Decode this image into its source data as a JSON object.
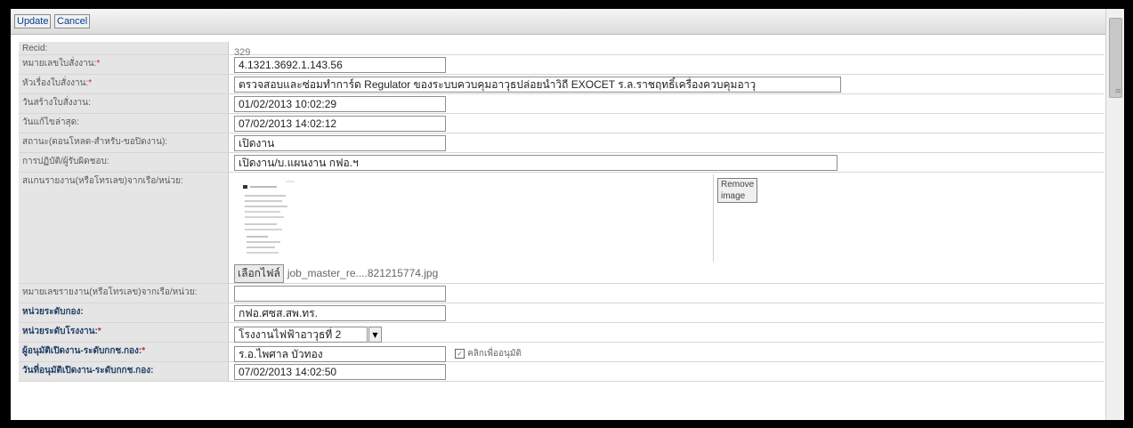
{
  "toolbar": {
    "update_label": "Update",
    "cancel_label": "Cancel"
  },
  "fields": {
    "recid": {
      "label": "Recid:",
      "value": "329"
    },
    "job_no": {
      "label": "หมายเลขใบสั่งงาน:",
      "req": "*",
      "value": "4.1321.3692.1.143.56"
    },
    "job_title": {
      "label": "หัวเรื่องใบสั่งงาน:",
      "req": "*",
      "value": "ตรวจสอบและซ่อมทำการ์ด Regulator ของระบบควบคุมอาวุธปล่อยนำวิถี EXOCET ร.ล.ราชฤทธิ์เครื่องควบคุมอาวุ"
    },
    "created": {
      "label": "วันสร้างใบสั่งงาน:",
      "value": "01/02/2013 10:02:29"
    },
    "modified": {
      "label": "วันแก้ไขล่าสุด:",
      "value": "07/02/2013 14:02:12"
    },
    "status": {
      "label": "สถานะ(ตอนโหลด-สำหรับ-ขอปิดงาน):",
      "value": "เปิดงาน"
    },
    "operation": {
      "label": "การปฏิบัติ/ผู้รับผิดชอบ:",
      "value": "เปิดงาน/บ.แผนงาน กฟอ.ฯ"
    },
    "report_img": {
      "label": "สแกนรายงาน(หรือโทรเลข)จากเรือ/หน่วย:",
      "remove_label": "Remove image",
      "file_button": "เลือกไฟล์",
      "file_name": "job_master_re....821215774.jpg"
    },
    "report_no": {
      "label": "หมายเลขรายงาน(หรือโทรเลข)จากเรือ/หน่วย:",
      "value": ""
    },
    "division": {
      "label": "หน่วยระดับกอง:",
      "value": "กฟอ.ศซส.สพ.ทร."
    },
    "factory": {
      "label": "หน่วยระดับโรงงาน:",
      "req": "*",
      "value": "โรงงานไฟฟ้าอาวุธที่ 2"
    },
    "approver": {
      "label": "ผู้อนุมัติเปิดงาน-ระดับกกช.กอง:",
      "req": "*",
      "value": "ร.อ.ไพศาล บัวทอง",
      "check_label": "คลิกเพื่ออนุมัติ"
    },
    "approve_date": {
      "label": "วันที่อนุมัติเปิดงาน-ระดับกกช.กอง:",
      "value": "07/02/2013 14:02:50"
    }
  },
  "icons": {
    "dropdown": "chevron-down-icon",
    "scroll_grip": "grip-icon",
    "checkbox": "checkbox-icon"
  }
}
